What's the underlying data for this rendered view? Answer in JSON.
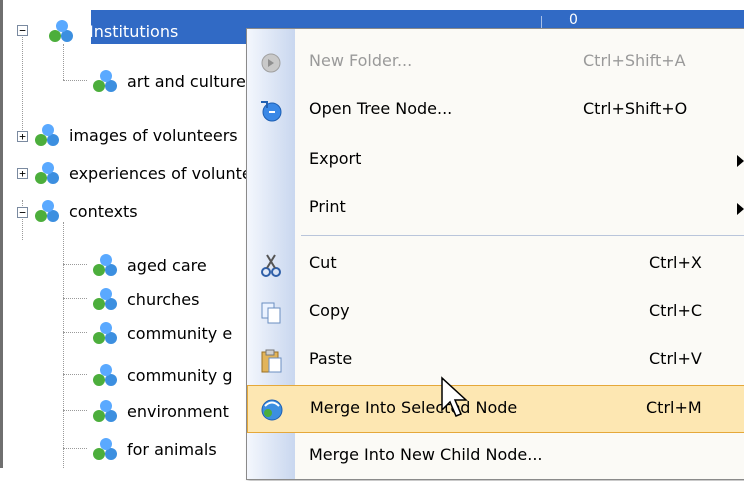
{
  "tree": {
    "selected": {
      "label": "Institutions",
      "count": "0"
    },
    "nodes": [
      {
        "label": "art and culture",
        "icon": "network-node-icon"
      },
      {
        "label": "images of volunteers",
        "icon": "network-node-icon"
      },
      {
        "label": "experiences of volunteers",
        "icon": "network-node-icon"
      },
      {
        "label": "contexts",
        "icon": "network-node-icon"
      },
      {
        "label": "aged care",
        "icon": "network-node-icon"
      },
      {
        "label": "churches",
        "icon": "network-node-icon"
      },
      {
        "label": "community e",
        "icon": "network-node-icon"
      },
      {
        "label": "community g",
        "icon": "network-node-icon"
      },
      {
        "label": "environment",
        "icon": "network-node-icon"
      },
      {
        "label": "for animals",
        "icon": "network-node-icon"
      }
    ],
    "toggles": {
      "collapse": "−",
      "expand": "+"
    }
  },
  "context_menu": {
    "items": [
      {
        "label": "New Folder...",
        "shortcut": "Ctrl+Shift+A",
        "disabled": true,
        "icon": "new-folder-icon"
      },
      {
        "label": "Open Tree Node...",
        "shortcut": "Ctrl+Shift+O",
        "icon": "open-tree-node-icon"
      },
      {
        "label": "Export",
        "submenu": true
      },
      {
        "label": "Print",
        "submenu": true
      },
      {
        "label": "Cut",
        "shortcut": "Ctrl+X",
        "icon": "scissors-icon"
      },
      {
        "label": "Copy",
        "shortcut": "Ctrl+C",
        "icon": "copy-icon"
      },
      {
        "label": "Paste",
        "shortcut": "Ctrl+V",
        "icon": "paste-icon"
      },
      {
        "label": "Merge Into Selected Node",
        "shortcut": "Ctrl+M",
        "highlighted": true,
        "icon": "merge-icon"
      },
      {
        "label": "Merge Into New Child Node..."
      }
    ]
  },
  "colors": {
    "selection": "#316ac5",
    "menu_highlight": "#fde7b2",
    "menu_highlight_border": "#e5a83a"
  }
}
